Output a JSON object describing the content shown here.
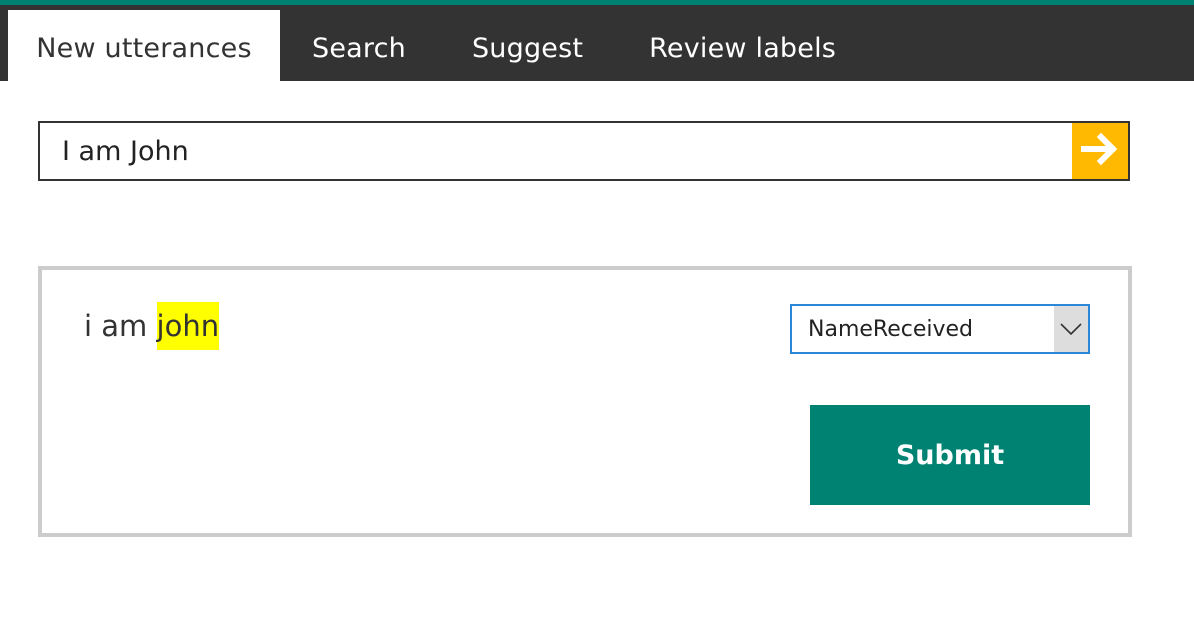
{
  "nav": {
    "tabs": [
      {
        "label": "New utterances",
        "active": true
      },
      {
        "label": "Search",
        "active": false
      },
      {
        "label": "Suggest",
        "active": false
      },
      {
        "label": "Review labels",
        "active": false
      }
    ]
  },
  "input": {
    "value": "I am John",
    "go_icon": "arrow-right-icon"
  },
  "result": {
    "utterance_prefix": "i am ",
    "entity_text": "john",
    "intent_selected": "NameReceived",
    "submit_label": "Submit"
  },
  "colors": {
    "accent": "#008272",
    "nav_bg": "#333333",
    "search_button": "#ffb900",
    "entity_highlight": "#ffff00",
    "select_border": "#2b88d8",
    "card_border": "#cccccc"
  }
}
